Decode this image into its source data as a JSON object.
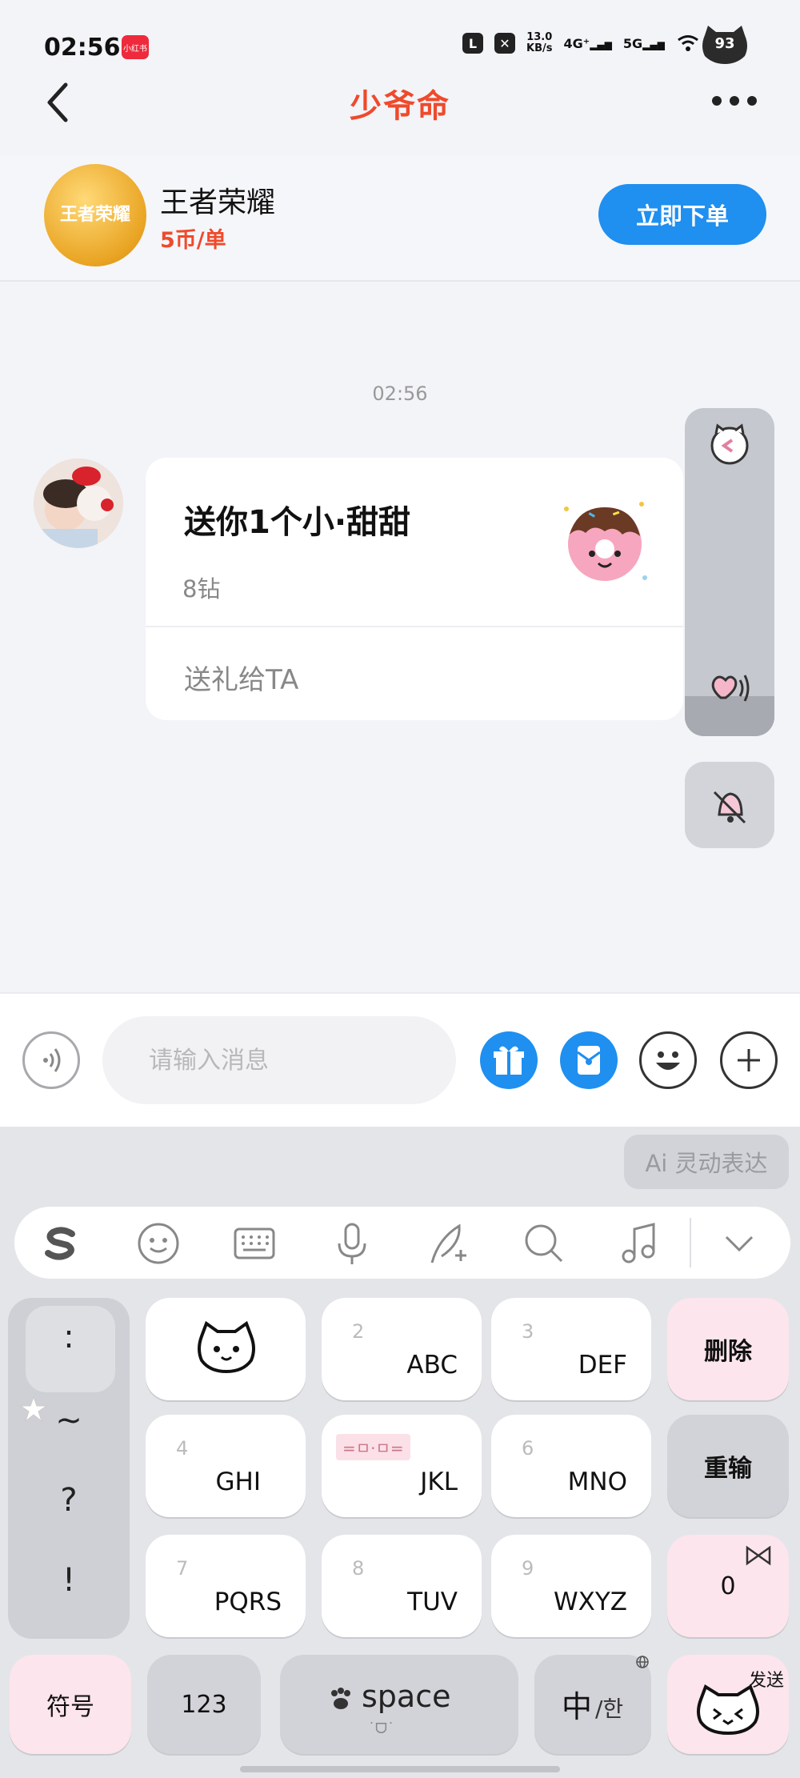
{
  "status_bar": {
    "time": "02:56",
    "app_badge": "小红书",
    "speed_value": "13.0",
    "speed_unit": "KB/s",
    "net1": "4G⁺",
    "net2": "5G",
    "battery": "93"
  },
  "header": {
    "title": "少爷命"
  },
  "game": {
    "name": "王者荣耀",
    "logo_text": "王者荣耀",
    "price": "5币/单",
    "order_button": "立即下单"
  },
  "chat": {
    "timestamp": "02:56",
    "gift_card": {
      "title": "送你1个小·甜甜",
      "price": "8钻",
      "action": "送礼给TA"
    }
  },
  "input": {
    "placeholder": "请输入消息"
  },
  "keyboard": {
    "ai_chip": "Ai 灵动表达",
    "symbols": [
      ":",
      "~",
      "?",
      "!"
    ],
    "keys": {
      "k2_num": "2",
      "k2_letters": "ABC",
      "k3_num": "3",
      "k3_letters": "DEF",
      "k4_num": "4",
      "k4_letters": "GHI",
      "k5_letters": "JKL",
      "k5_tag": "=ㅁ·ㅁ=",
      "k6_num": "6",
      "k6_letters": "MNO",
      "k7_num": "7",
      "k7_letters": "PQRS",
      "k8_num": "8",
      "k8_letters": "TUV",
      "k9_num": "9",
      "k9_letters": "WXYZ"
    },
    "delete": "删除",
    "reenter": "重输",
    "zero": "0",
    "symbols_key": "符号",
    "numbers_key": "123",
    "space_key": "space",
    "space_sub": "˙ᗜ˙",
    "lang_key_main": "中",
    "lang_key_sub": "/한",
    "send_key": "发送"
  },
  "colors": {
    "title": "#ef4a2c",
    "primary": "#1f8ff0",
    "price": "#ef4a2c",
    "pink_key": "#fce5ec"
  }
}
